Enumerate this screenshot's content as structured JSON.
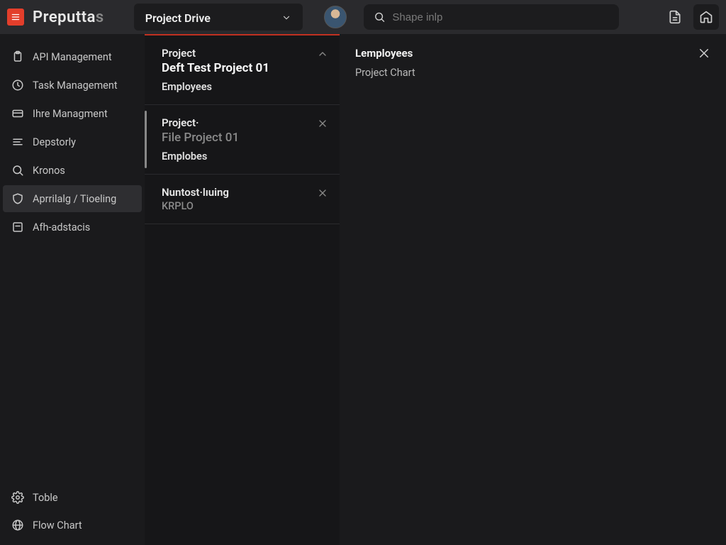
{
  "header": {
    "logo_text": "Preputta",
    "logo_suffix": "s",
    "project_selector": "Project Drive",
    "search_placeholder": "Shape inlp"
  },
  "sidebar": {
    "items": [
      {
        "label": "API Management",
        "icon": "clipboard-icon"
      },
      {
        "label": "Task Management",
        "icon": "clock-icon"
      },
      {
        "label": "Ihre Managment",
        "icon": "card-icon"
      },
      {
        "label": "Depstorly",
        "icon": "lines-icon"
      },
      {
        "label": "Kronos",
        "icon": "search-icon"
      },
      {
        "label": "Aprrilalg / Tioeling",
        "icon": "shield-icon"
      },
      {
        "label": "Afh-adstacis",
        "icon": "square-icon"
      }
    ],
    "bottom_items": [
      {
        "label": "Toble",
        "icon": "gear-icon"
      },
      {
        "label": "Flow Chart",
        "icon": "globe-icon"
      }
    ],
    "active_index": 5
  },
  "middle": {
    "cards": [
      {
        "eyebrow": "Project",
        "title": "Deft Test Project 01",
        "subtitle": "Employees",
        "action": "collapse",
        "title_muted": false
      },
      {
        "eyebrow": "Project·",
        "title": "File Project 01",
        "subtitle": "Emplobes",
        "action": "close",
        "title_muted": true,
        "selected": true
      },
      {
        "eyebrow": "Nuntost·lıuing",
        "title": "",
        "subtitle": "KRPLO",
        "action": "close",
        "subtitle_muted": true
      }
    ]
  },
  "right": {
    "title": "Lemployees",
    "subtitle": "Project Chart"
  }
}
